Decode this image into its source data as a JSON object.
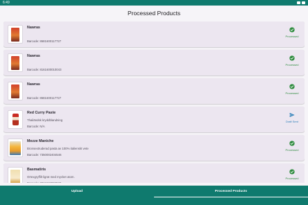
{
  "status_bar": {
    "time": "6:49"
  },
  "page_title": "Processed Products",
  "products": [
    {
      "thumb": "red",
      "name": "Nawras",
      "description": "",
      "barcode": "Barcode: 8681600117727",
      "status": "processed",
      "status_label": "Processed"
    },
    {
      "thumb": "red",
      "name": "Nawras",
      "description": "",
      "barcode": "Barcode: 8161600010043",
      "status": "processed",
      "status_label": "Processed"
    },
    {
      "thumb": "red",
      "name": "Nawras",
      "description": "",
      "barcode": "Barcode: 8681600117727",
      "status": "processed",
      "status_label": "Processed"
    },
    {
      "thumb": "jar",
      "name": "Red Curry Paste",
      "description": "Thailändsk kryddblandning",
      "barcode": "Barcode: N/A",
      "status": "draft",
      "status_label": "Draft Sent"
    },
    {
      "thumb": "pasta",
      "name": "Mezze Maniche",
      "description": "Bronsextruderad pasta av 100% italienskt vete",
      "barcode": "Barcode: 7350002404546",
      "status": "processed",
      "status_label": "Processed"
    },
    {
      "thumb": "basmati",
      "name": "Basmatiris",
      "description": "Ortexgryffilt ligrat med mycket atom.",
      "barcode": "Barcode: 7311043002528",
      "status": "processed",
      "status_label": "Processed"
    }
  ],
  "colors": {
    "primary": "#0f7a6e",
    "processed": "#2e8b3e",
    "draft": "#2c7fb8"
  },
  "bottom_nav": [
    {
      "label": "Upload",
      "active": false
    },
    {
      "label": "Processed Products",
      "active": true
    }
  ]
}
